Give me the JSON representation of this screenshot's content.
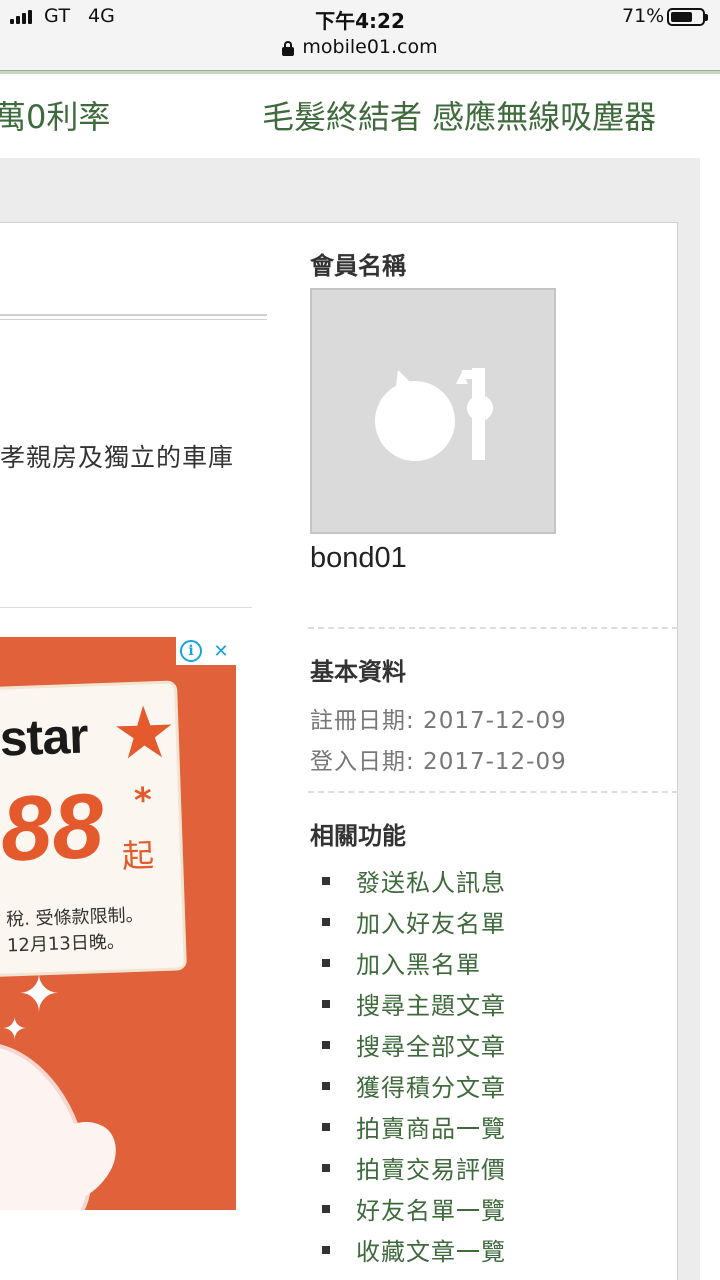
{
  "status_bar": {
    "carrier": "GT",
    "network": "4G",
    "time": "下午4:22",
    "battery_percent": "71%",
    "battery_level": 0.71
  },
  "url_bar": {
    "url": "mobile01.com"
  },
  "headline_strip": {
    "left_text": "萬0利率",
    "right_text": "毛髮終結者 感應無線吸塵器"
  },
  "post": {
    "snippet": "孝親房及獨立的車庫"
  },
  "ad": {
    "brand": "star",
    "price": "88",
    "asterisk": "*",
    "from_label": "起",
    "fine_print_1": "稅. 受條款限制。",
    "fine_print_2": "12月13日晚。",
    "info_icon": "info-icon",
    "close_icon": "close-icon",
    "background_color": "#e0613a"
  },
  "member": {
    "section_title": "會員名稱",
    "username": "bond01",
    "avatar_icon": "default-avatar-icon"
  },
  "basic_info": {
    "section_title": "基本資料",
    "register_date": "註冊日期: 2017-12-09",
    "login_date": "登入日期: 2017-12-09"
  },
  "related_functions": {
    "section_title": "相關功能",
    "items": [
      {
        "label": "發送私人訊息"
      },
      {
        "label": "加入好友名單"
      },
      {
        "label": "加入黑名單"
      },
      {
        "label": "搜尋主題文章"
      },
      {
        "label": "搜尋全部文章"
      },
      {
        "label": "獲得積分文章"
      },
      {
        "label": "拍賣商品一覽"
      },
      {
        "label": "拍賣交易評價"
      },
      {
        "label": "好友名單一覽"
      },
      {
        "label": "收藏文章一覽"
      }
    ]
  },
  "colors": {
    "link_green": "#3f6a3c",
    "background_grey": "#ececec"
  }
}
